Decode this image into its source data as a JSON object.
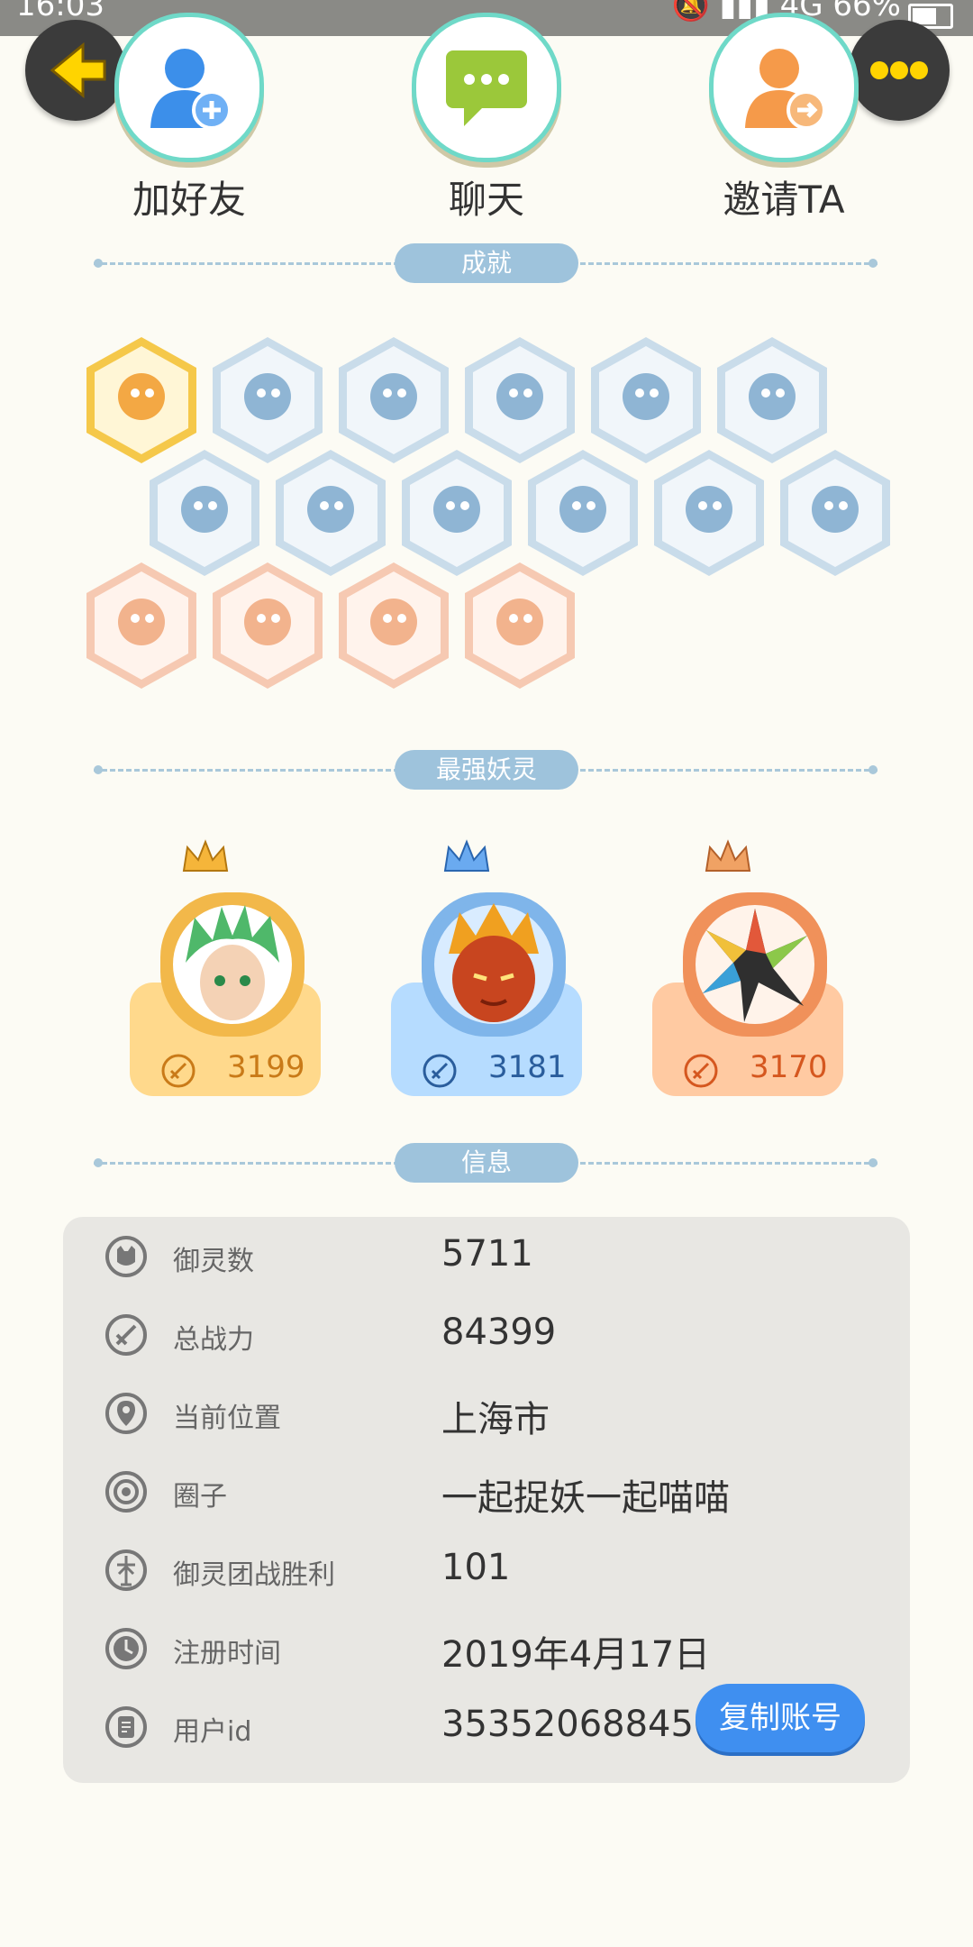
{
  "status_bar": {
    "time": "16:03",
    "network": "4G",
    "battery": "66%"
  },
  "actions": [
    {
      "label": "加好友",
      "icon": "person-add-icon"
    },
    {
      "label": "聊天",
      "icon": "chat-icon"
    },
    {
      "label": "邀请TA",
      "icon": "person-invite-icon"
    }
  ],
  "sections": {
    "achievements": "成就",
    "strongest": "最强妖灵",
    "info": "信息"
  },
  "achievement_badges": {
    "row1": [
      "gold",
      "blue",
      "blue",
      "blue",
      "blue",
      "blue"
    ],
    "row2": [
      "blue",
      "blue",
      "blue",
      "blue",
      "blue",
      "blue"
    ],
    "row3": [
      "orange",
      "orange",
      "orange",
      "orange"
    ]
  },
  "strongest_spirits": [
    {
      "power": "3199",
      "theme": "gold",
      "card_color": "#ffd98c",
      "num_color": "#c97a18"
    },
    {
      "power": "3181",
      "theme": "blue",
      "card_color": "#b6dcff",
      "num_color": "#2a5d9c"
    },
    {
      "power": "3170",
      "theme": "orange",
      "card_color": "#ffcaa2",
      "num_color": "#d5571f"
    }
  ],
  "info_rows": [
    {
      "key": "御灵数",
      "value": "5711",
      "icon": "spirit-icon"
    },
    {
      "key": "总战力",
      "value": "84399",
      "icon": "sword-icon"
    },
    {
      "key": "当前位置",
      "value": "上海市",
      "icon": "location-pin-icon"
    },
    {
      "key": "圈子",
      "value": "一起捉妖一起喵喵",
      "icon": "circle-target-icon"
    },
    {
      "key": "御灵团战胜利",
      "value": "101",
      "icon": "trophy-icon"
    },
    {
      "key": "注册时间",
      "value": "2019年4月17日",
      "icon": "clock-icon"
    },
    {
      "key": "用户id",
      "value": "35352068845",
      "icon": "id-card-icon"
    }
  ],
  "copy_button": "复制账号"
}
